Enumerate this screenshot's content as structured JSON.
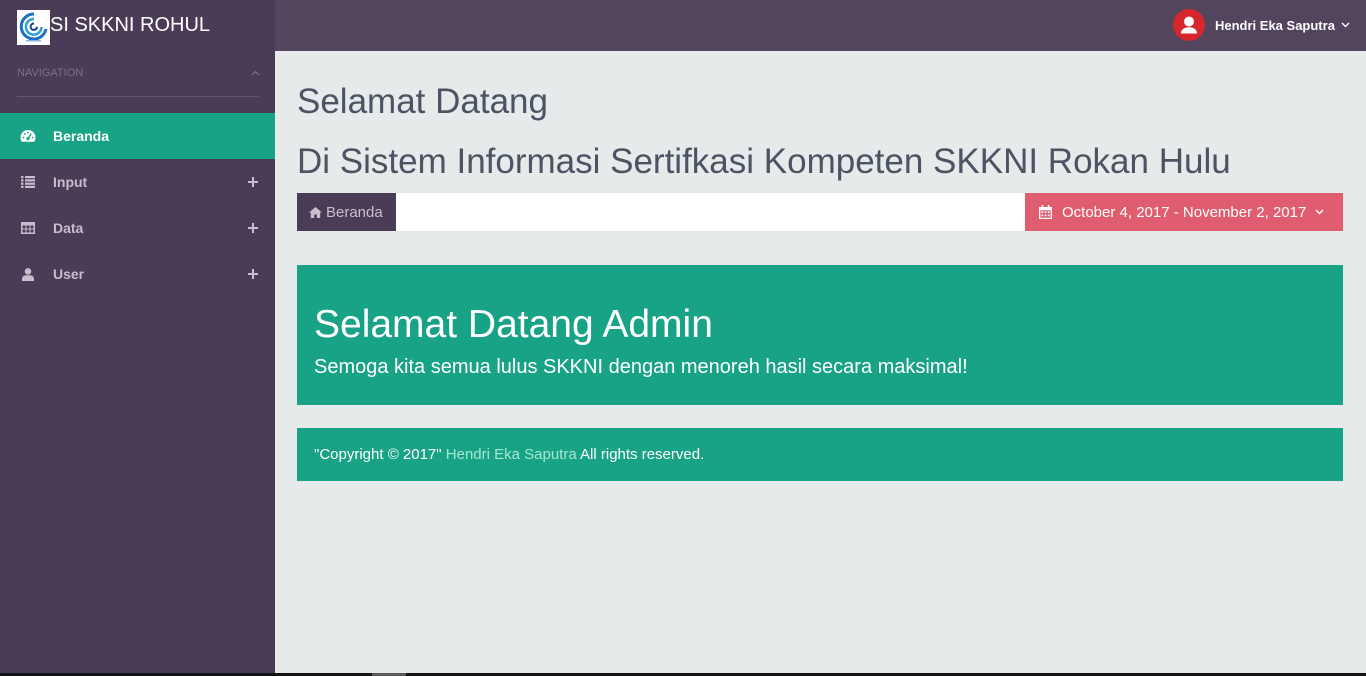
{
  "app": {
    "brand": "SI SKKNI ROHUL",
    "logo_icon": "app-logo-icon"
  },
  "header": {
    "user_name": "Hendri Eka Saputra",
    "avatar_icon": "user-avatar-icon",
    "menu_icon": "chevron-down-icon"
  },
  "sidebar": {
    "section_label": "NAVIGATION",
    "section_toggle_icon": "chevron-up-icon",
    "items": [
      {
        "label": "Beranda",
        "icon": "dashboard-icon",
        "active": true,
        "expandable": false
      },
      {
        "label": "Input",
        "icon": "list-icon",
        "active": false,
        "expandable": true
      },
      {
        "label": "Data",
        "icon": "table-icon",
        "active": false,
        "expandable": true
      },
      {
        "label": "User",
        "icon": "user-icon",
        "active": false,
        "expandable": true
      }
    ]
  },
  "page": {
    "title": "Selamat Datang",
    "subtitle": "Di Sistem Informasi Sertifkasi Kompeten SKKNI Rokan Hulu",
    "breadcrumb": {
      "icon": "home-icon",
      "label": "Beranda"
    },
    "date_range": {
      "icon": "calendar-icon",
      "label": "October 4, 2017 - November 2, 2017",
      "menu_icon": "chevron-down-icon"
    }
  },
  "welcome": {
    "heading": "Selamat Datang Admin",
    "message": "Semoga kita semua lulus SKKNI dengan menoreh hasil secara maksimal!"
  },
  "footer": {
    "prefix": "\"Copyright © 2017\"",
    "author": "Hendri Eka Saputra",
    "suffix": "All rights reserved."
  },
  "colors": {
    "sidebar": "#4a3c57",
    "header": "#54455e",
    "accent": "#18a387",
    "date_button": "#e05d6f",
    "avatar": "#d8262d",
    "page_background": "#e7eaeb",
    "heading_text": "#4a5462",
    "footer_link": "#a8e6d2"
  }
}
